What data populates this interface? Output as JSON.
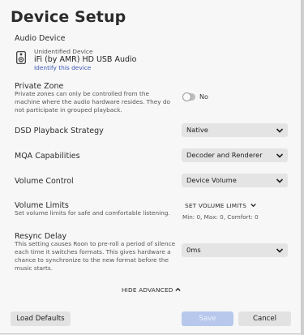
{
  "dialog": {
    "title": "Device Setup"
  },
  "audio_device": {
    "label": "Audio Device",
    "status": "Unidentified Device",
    "name": "iFi (by AMR) HD USB Audio",
    "identify_link": "Identify this device"
  },
  "private_zone": {
    "label": "Private Zone",
    "description_line1": "Private zones can only be controlled from the",
    "description_line2": "machine where the audio hardware resides. They do",
    "description_line3": "not participate in grouped playback.",
    "toggle_on": false,
    "toggle_text": "No"
  },
  "dsd": {
    "label": "DSD Playback Strategy",
    "value": "Native"
  },
  "mqa": {
    "label": "MQA Capabilities",
    "value": "Decoder and Renderer"
  },
  "volume_control": {
    "label": "Volume Control",
    "value": "Device Volume"
  },
  "volume_limits": {
    "label": "Volume Limits",
    "description": "Set volume limits for safe and comfortable listening.",
    "link": "SET VOLUME LIMITS",
    "values": "Min: 0, Max: 0, Comfort: 0"
  },
  "resync_delay": {
    "label": "Resync Delay",
    "description_line1": "This setting causes Roon to pre-roll a period of silence",
    "description_line2": "each time it switches formats. This gives hardware a",
    "description_line3": "chance to synchronize to the new format before the",
    "description_line4": "music starts.",
    "value": "0ms"
  },
  "advanced": {
    "toggle_label": "HIDE ADVANCED"
  },
  "footer": {
    "load_defaults": "Load Defaults",
    "save": "Save",
    "cancel": "Cancel"
  },
  "colors": {
    "link": "#3a57b8",
    "save_disabled": "#b7c8ec",
    "button_bg": "#e2e2e2",
    "select_bg": "#e4e4e4"
  }
}
